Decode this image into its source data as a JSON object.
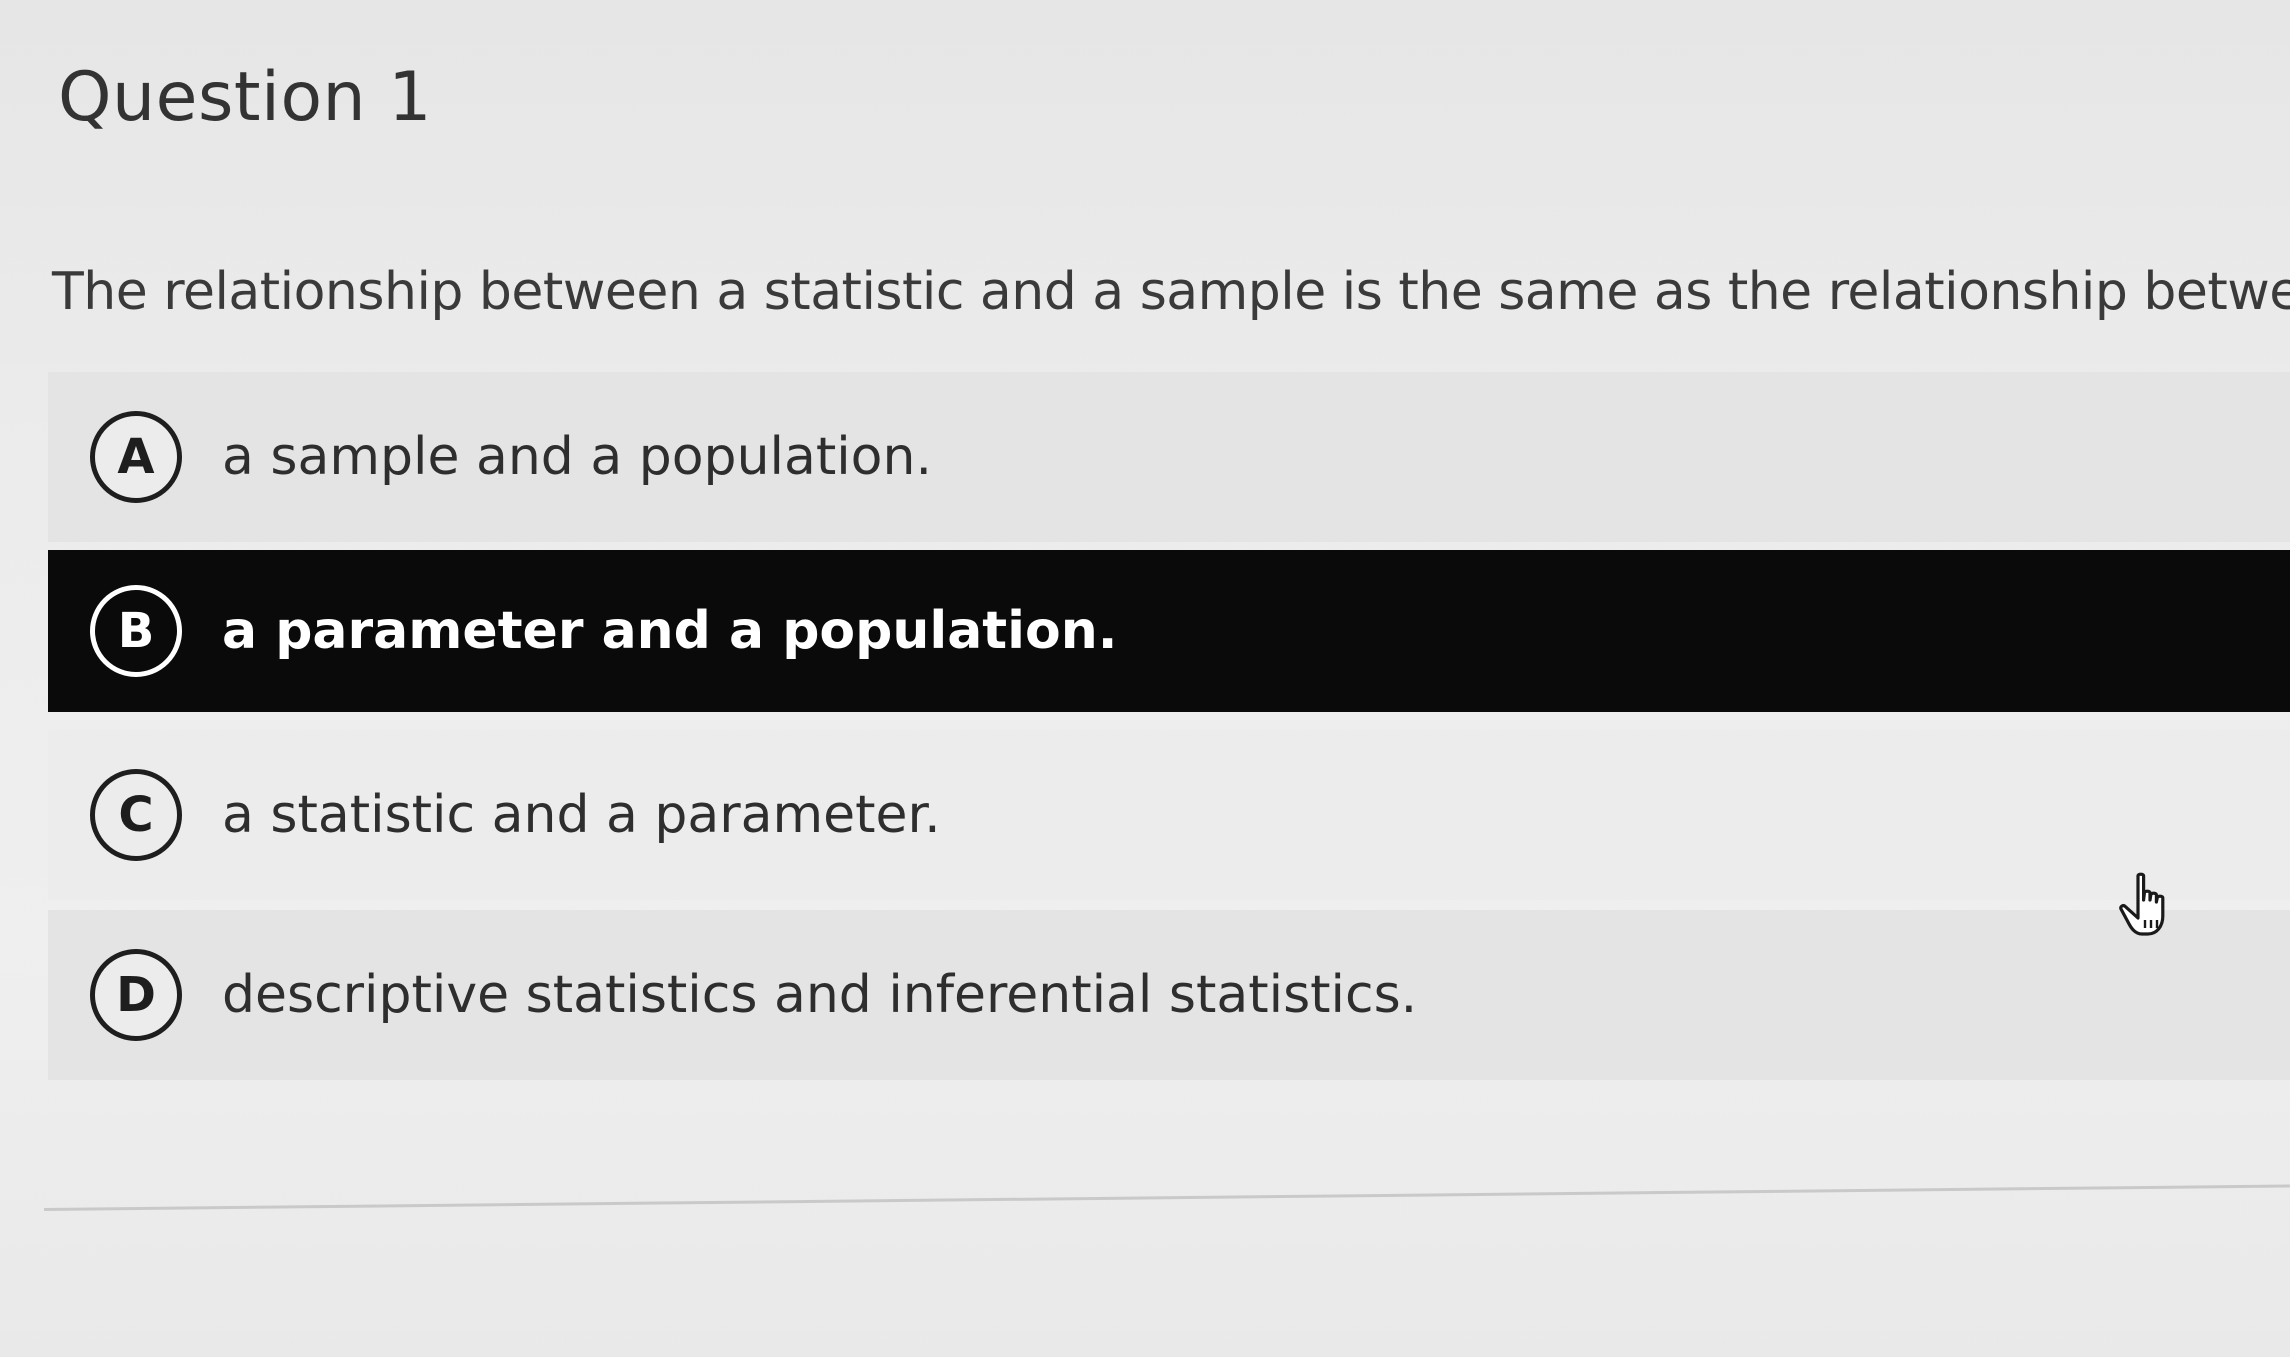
{
  "question": {
    "title": "Question 1",
    "prompt": "The relationship between a statistic and a sample is the same as the relationship between"
  },
  "options": [
    {
      "letter": "A",
      "label": "a sample and a population.",
      "selected": false
    },
    {
      "letter": "B",
      "label": "a parameter and a population.",
      "selected": true
    },
    {
      "letter": "C",
      "label": "a statistic and a parameter.",
      "selected": false
    },
    {
      "letter": "D",
      "label": "descriptive statistics and inferential statistics.",
      "selected": false
    }
  ],
  "colors": {
    "selected_background": "#0a0a0a",
    "selected_text": "#ffffff",
    "page_background": "#ececec",
    "text": "#333333"
  },
  "icons": {
    "cursor": "hand-pointer-icon",
    "option_marker": "circle-letter-badge"
  }
}
